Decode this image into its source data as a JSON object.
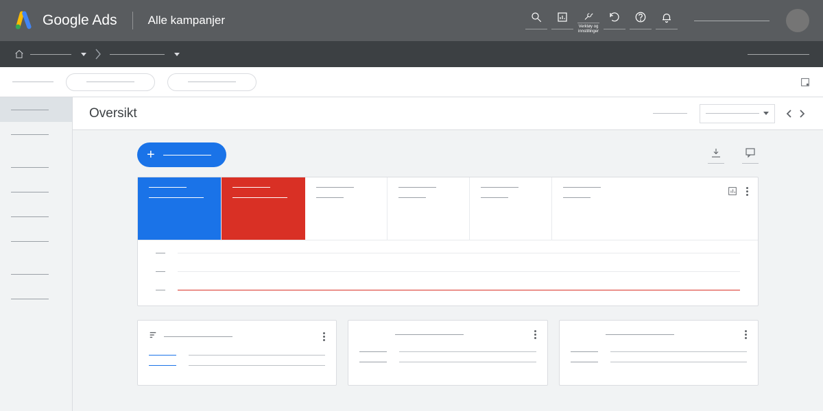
{
  "header": {
    "product": "Google Ads",
    "subtitle": "Alle kampanjer",
    "tools_label": "Verktøy og innstillinger"
  },
  "page": {
    "title": "Oversikt"
  },
  "colors": {
    "blue": "#1a73e8",
    "red": "#d93025"
  }
}
